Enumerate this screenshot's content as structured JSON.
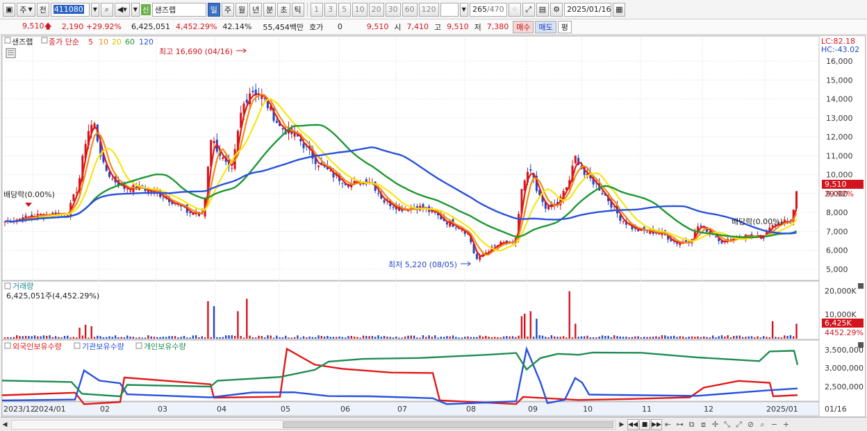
{
  "toolbar": {
    "type_label": "주",
    "prev_label": "전",
    "stock_code": "411080",
    "sin_badge": "신",
    "stock_name": "샌즈랩",
    "periods": [
      "일",
      "주",
      "월",
      "년",
      "분",
      "초",
      "틱"
    ],
    "active_period": "일",
    "intervals": [
      "1",
      "3",
      "5",
      "10",
      "20",
      "30",
      "60",
      "120"
    ],
    "count_current": "265",
    "count_total": "470",
    "date": "2025/01/16"
  },
  "quote": {
    "price": "9,510",
    "change": "2,190",
    "change_pct": "+29.92%",
    "volume": "6,425,051",
    "volume_pct": "4,452.29%",
    "turnover_pct": "42.14%",
    "amount": "55,454백만",
    "hoga_label": "호가",
    "hoga_value": "0",
    "hoga_price": "9,510",
    "open_label": "시",
    "open": "7,410",
    "high_label": "고",
    "high": "9,510",
    "low_label": "저",
    "low": "7,380",
    "buy_label": "매수",
    "sell_label": "매도",
    "eval_label": "평"
  },
  "price_panel": {
    "name_tag": "샌즈랩",
    "ma_label": "종가 단순",
    "ma_periods": [
      "5",
      "10",
      "20",
      "60",
      "120"
    ],
    "ma_colors": [
      "#e01818",
      "#f08c14",
      "#f5e614",
      "#1e9632",
      "#2850dc"
    ],
    "y_ticks": [
      "16,000",
      "15,000",
      "14,000",
      "13,000",
      "12,000",
      "11,000",
      "10,000",
      "9,000",
      "8,000",
      "7,000",
      "6,000",
      "5,000"
    ],
    "lc": "LC:82.18",
    "hc": "HC:-43.02",
    "current_price_tag": "9,510",
    "current_pct_tag": "29.92%",
    "max_annotation": "최고 16,690 (04/16)",
    "min_annotation": "최저 5,220 (08/05)",
    "dividend_left": "배당락(0.00%)",
    "dividend_right": "배당락(0.00%)"
  },
  "volume_panel": {
    "title": "거래량",
    "info": "6,425,051주(4,452.29%)",
    "y_ticks": [
      "20,000K",
      "10,000K"
    ],
    "current_tag": "6,425K",
    "current_pct_tag": "4452.29%"
  },
  "holding_panel": {
    "legend": [
      {
        "label": "외국인보유수량",
        "color": "#e01818"
      },
      {
        "label": "기관보유수량",
        "color": "#2850dc"
      },
      {
        "label": "개인보유수량",
        "color": "#1e8c50"
      }
    ],
    "y_ticks": [
      "3,500,000",
      "3,000,000",
      "2,500,000"
    ]
  },
  "x_axis": {
    "labels": [
      "2023/12",
      "2024/01",
      "02",
      "03",
      "04",
      "05",
      "06",
      "07",
      "08",
      "09",
      "10",
      "11",
      "12",
      "2025/01",
      "01/16"
    ]
  },
  "colors": {
    "up": "#d2141e",
    "down": "#1e46c8",
    "active_tab": "#3a6fc2"
  }
}
